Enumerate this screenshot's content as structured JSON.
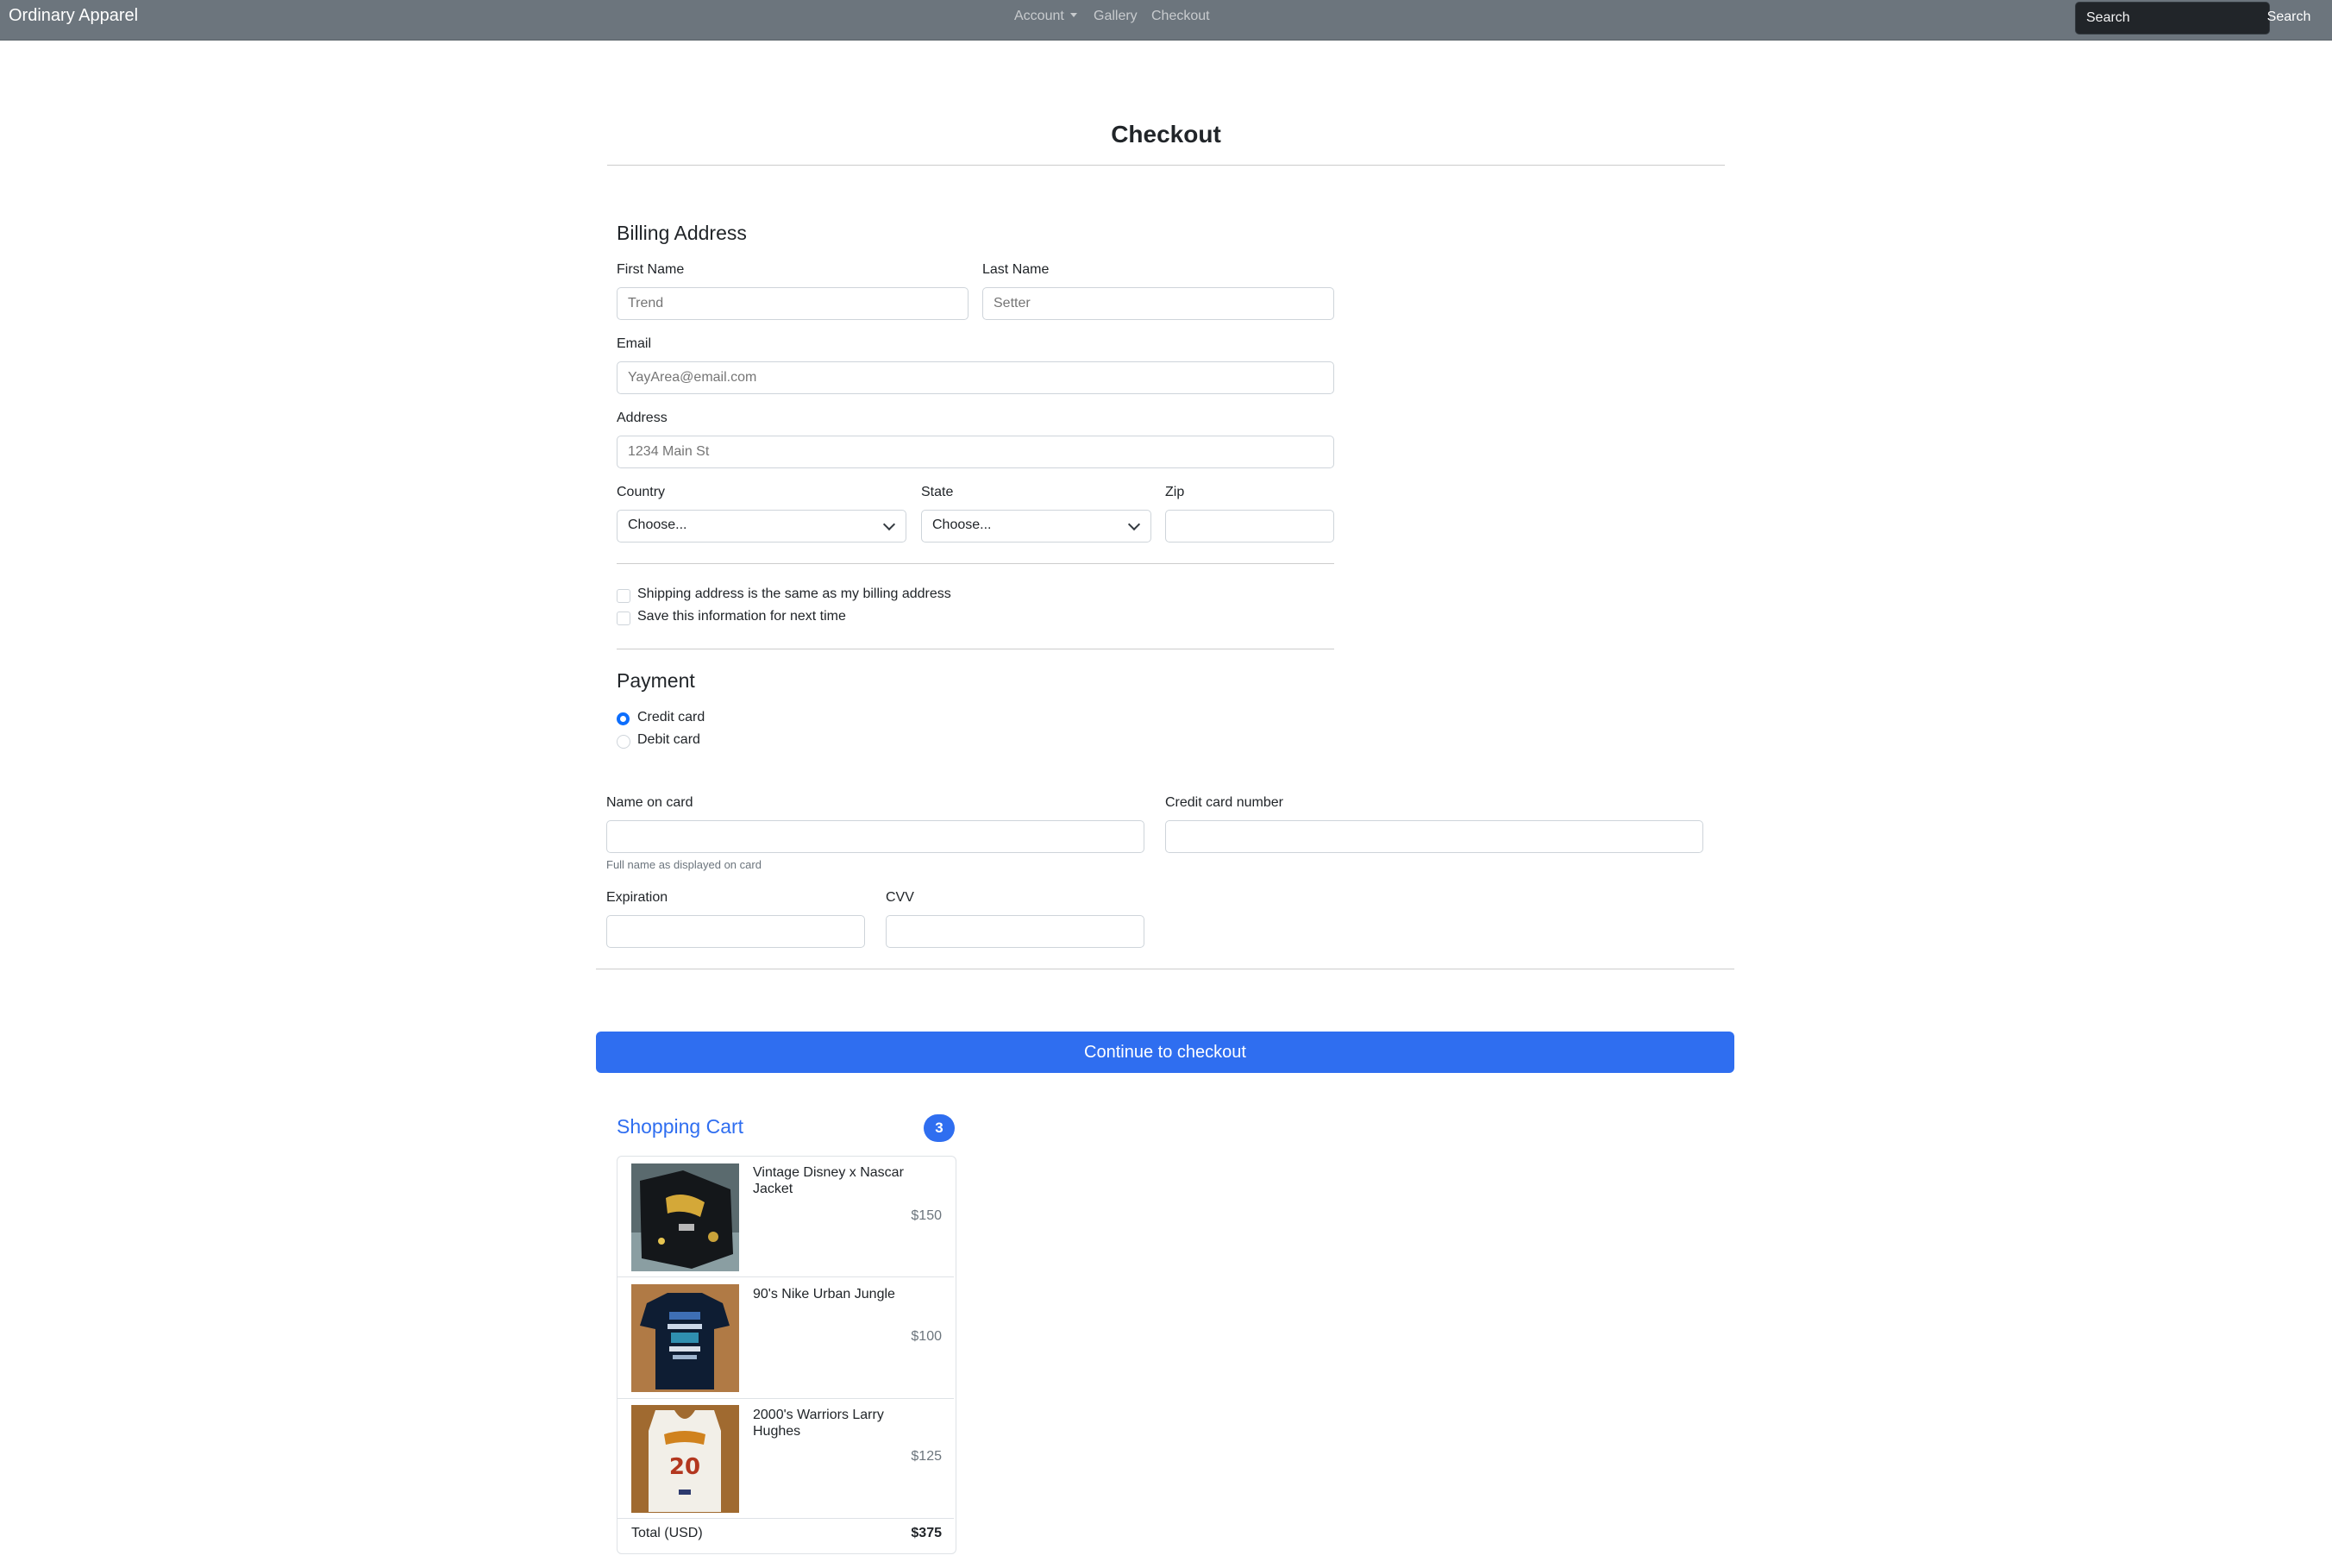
{
  "navbar": {
    "brand": "Ordinary Apparel",
    "links": [
      {
        "label": "Account"
      },
      {
        "label": "Gallery"
      },
      {
        "label": "Checkout"
      }
    ],
    "search_placeholder": "Search",
    "search_button": "Search"
  },
  "page_title": "Checkout",
  "billing": {
    "heading": "Billing Address",
    "first_name": {
      "label": "First Name",
      "placeholder": "Trend"
    },
    "last_name": {
      "label": "Last Name",
      "placeholder": "Setter"
    },
    "email": {
      "label": "Email",
      "placeholder": "YayArea@email.com"
    },
    "address": {
      "label": "Address",
      "placeholder": "1234 Main St"
    },
    "country": {
      "label": "Country",
      "value": "Choose..."
    },
    "state": {
      "label": "State",
      "value": "Choose..."
    },
    "zip": {
      "label": "Zip",
      "placeholder": ""
    },
    "same_address": "Shipping address is the same as my billing address",
    "save_info": "Save this information for next time"
  },
  "payment": {
    "heading": "Payment",
    "options": [
      {
        "label": "Credit card",
        "checked": true
      },
      {
        "label": "Debit card",
        "checked": false
      }
    ],
    "name_on_card": {
      "label": "Name on card",
      "help": "Full name as displayed on card"
    },
    "card_number": {
      "label": "Credit card number"
    },
    "expiration": {
      "label": "Expiration"
    },
    "cvv": {
      "label": "CVV"
    }
  },
  "continue_button": "Continue to checkout",
  "cart": {
    "title": "Shopping Cart",
    "count": "3",
    "items": [
      {
        "name": "Vintage Disney x Nascar Jacket",
        "price": "$150"
      },
      {
        "name": "90's Nike Urban Jungle",
        "price": "$100"
      },
      {
        "name": "2000's Warriors Larry Hughes",
        "price": "$125"
      }
    ],
    "total_label": "Total (USD)",
    "total_value": "$375"
  }
}
